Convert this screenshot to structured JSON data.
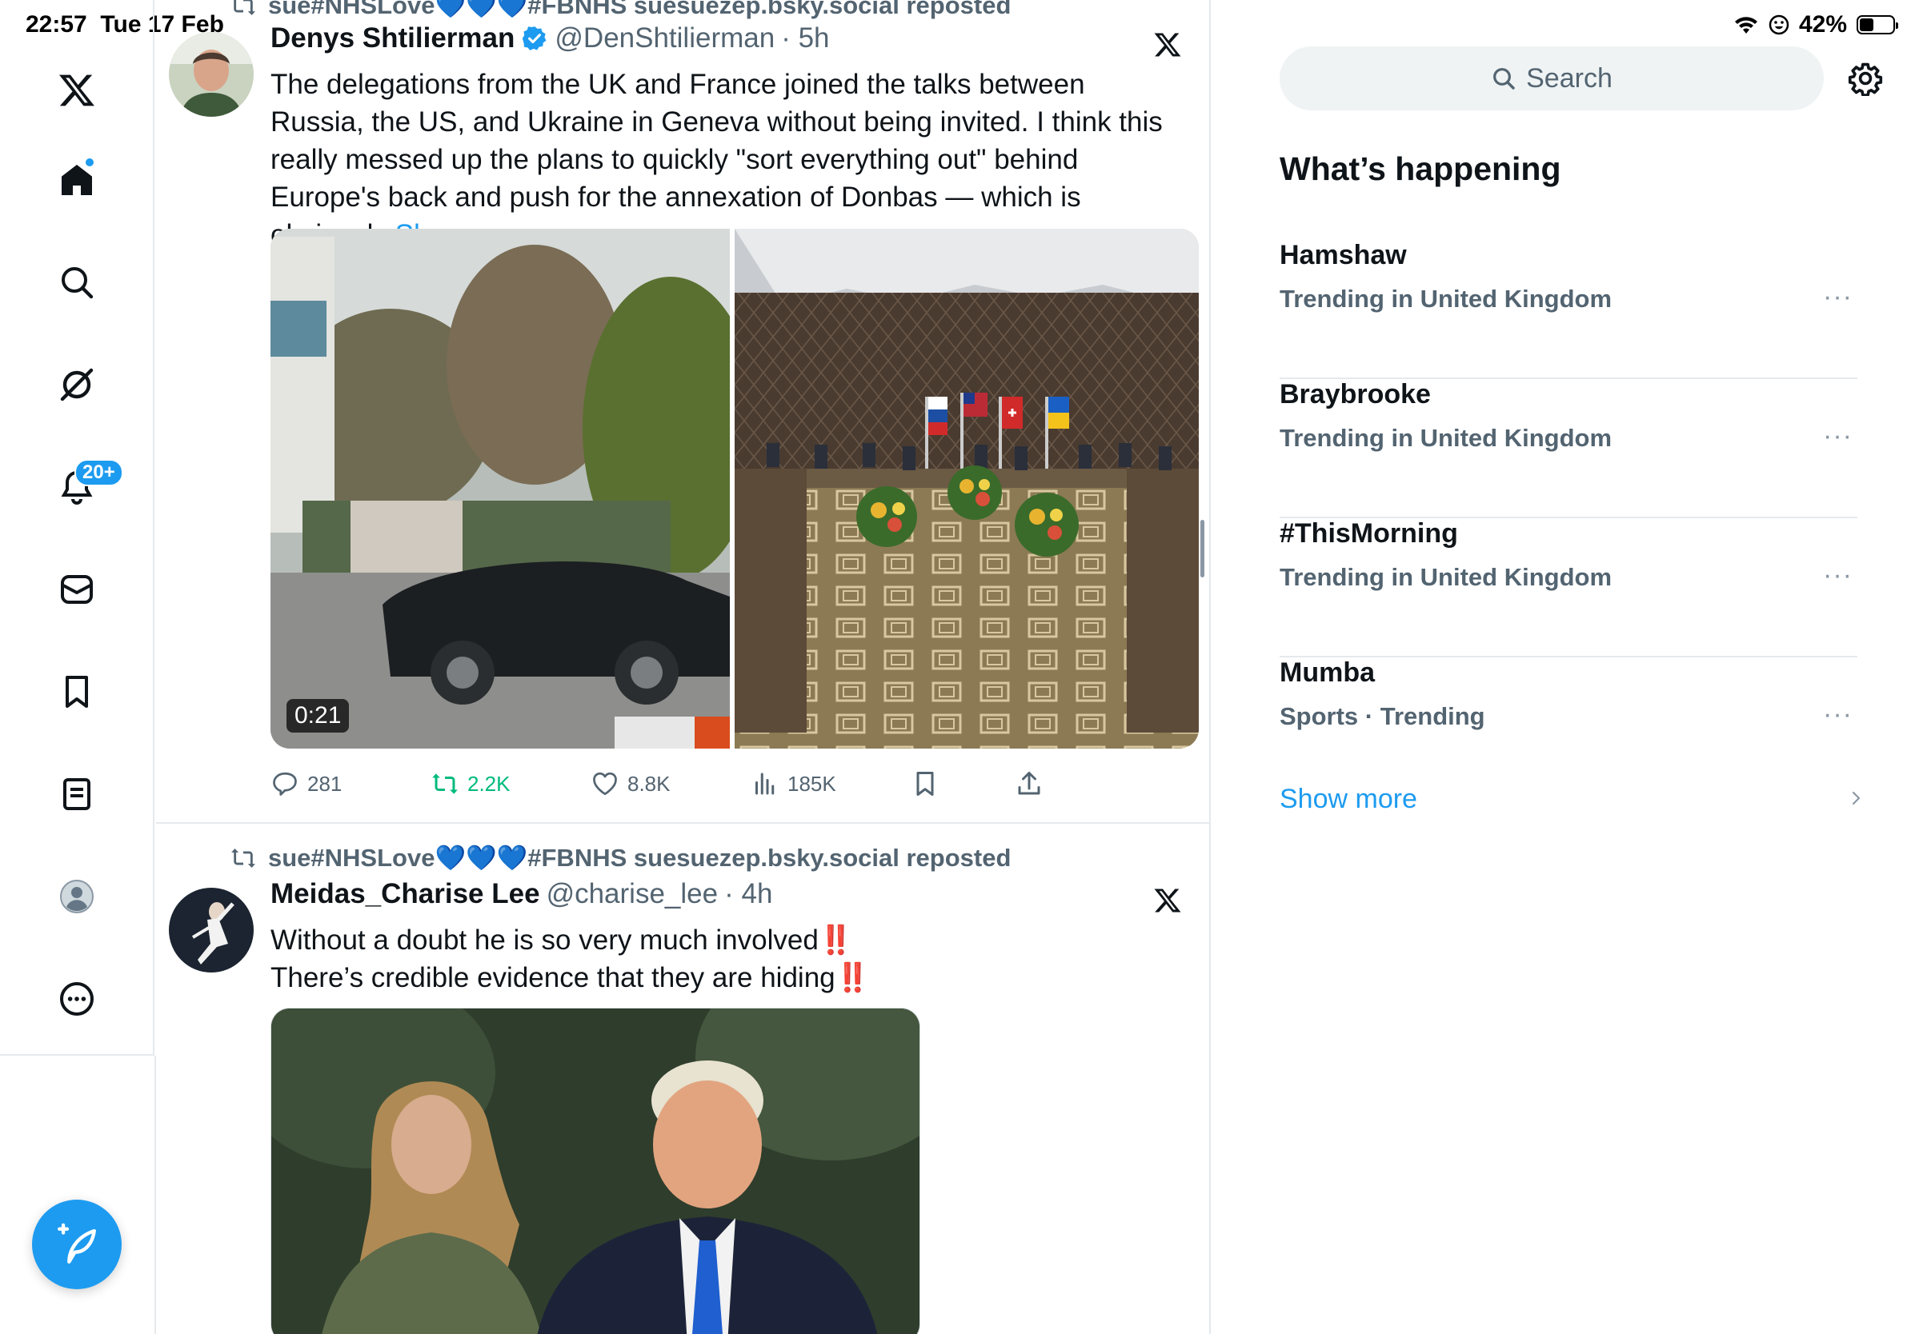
{
  "status_bar": {
    "time": "22:57",
    "date": "Tue 17 Feb",
    "battery": "42%",
    "battery_level": 0.42
  },
  "nav": {
    "items": [
      {
        "name": "x-logo-icon"
      },
      {
        "name": "home-icon"
      },
      {
        "name": "explore-icon"
      },
      {
        "name": "grok-icon"
      },
      {
        "name": "notifications-icon",
        "badge": "20+"
      },
      {
        "name": "messages-icon"
      },
      {
        "name": "bookmarks-icon"
      },
      {
        "name": "lists-icon"
      },
      {
        "name": "profile-icon"
      },
      {
        "name": "more-icon"
      }
    ],
    "compose": "compose-icon"
  },
  "feed": {
    "tweets": [
      {
        "repost_by": "sue#NHSLove💙💙💙#FBNHS suesuezep.bsky.social reposted",
        "name": "Denys Shtilierman",
        "handle": "@DenShtilierman",
        "time": "· 5h",
        "text": "The delegations from the UK and France joined the talks between Russia, the US, and Ukraine in Geneva without being invited. I think this really messed up the plans to quickly \"sort everything out\" behind Europe's back and push for the annexation of Donbas — which is obviously",
        "show_more": "Show more",
        "video_duration": "0:21",
        "replies": "281",
        "reposts": "2.2K",
        "likes": "8.8K",
        "views": "185K"
      },
      {
        "repost_by": "sue#NHSLove💙💙💙#FBNHS suesuezep.bsky.social reposted",
        "name": "Meidas_Charise Lee",
        "handle": "@charise_lee",
        "time": "· 4h",
        "line1": "Without a doubt he is so very much involved",
        "line2": "There’s credible evidence that they are hiding",
        "bang": "‼️"
      }
    ]
  },
  "sidebar": {
    "search_placeholder": "Search",
    "section_title": "What’s happening",
    "trends": [
      {
        "name": "Hamshaw",
        "meta": "Trending in United Kingdom"
      },
      {
        "name": "Braybrooke",
        "meta": "Trending in United Kingdom"
      },
      {
        "name": "#ThisMorning",
        "meta": "Trending in United Kingdom"
      },
      {
        "name": "Mumba",
        "meta": "Sports · Trending"
      }
    ],
    "show_more": "Show more",
    "dots": "···"
  },
  "colors": {
    "accent": "#1d9bf0",
    "repost_green": "#00ba7c",
    "muted": "#536471",
    "alert_red": "#e0241b"
  }
}
